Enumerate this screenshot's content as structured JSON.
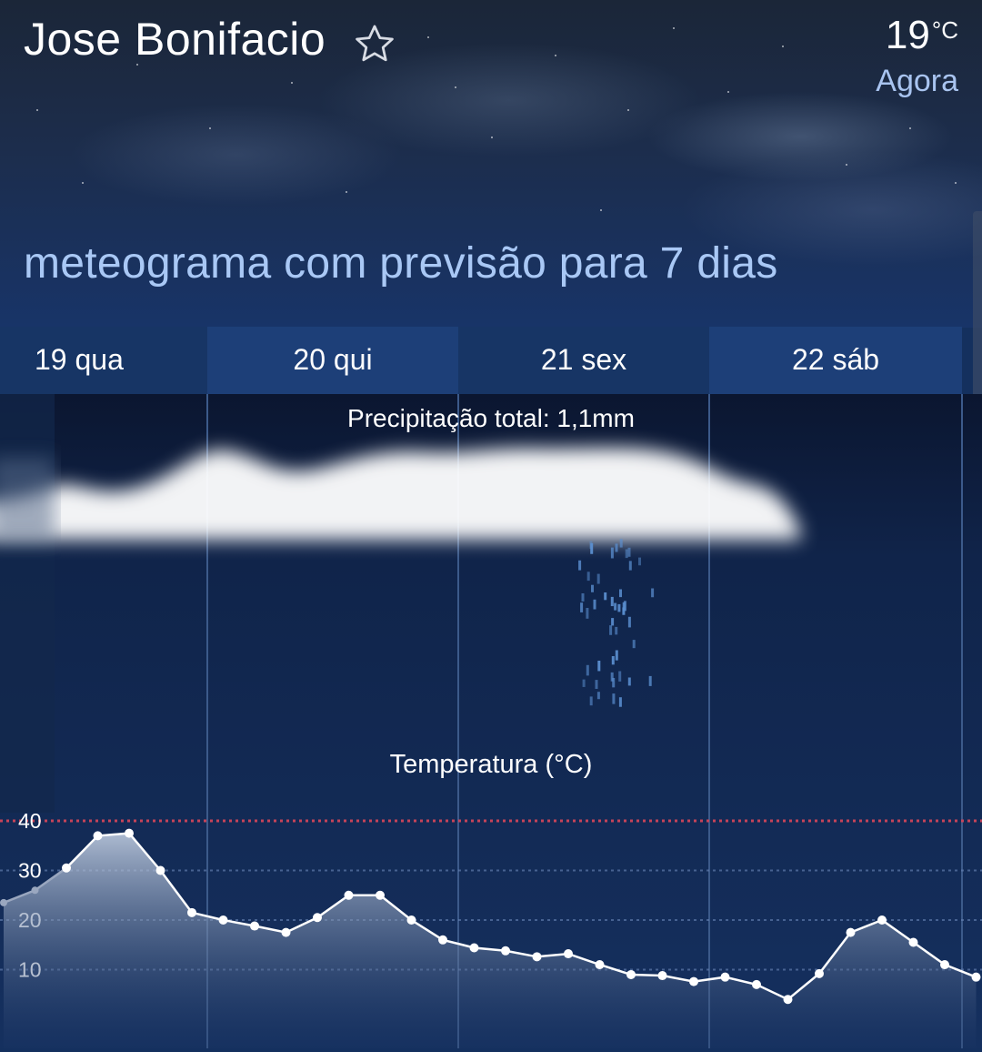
{
  "header": {
    "city": "Jose Bonifacio",
    "temperature": "19",
    "temperature_unit": "°C",
    "time_label": "Agora",
    "favorite_icon": "star-outline-icon"
  },
  "meteogram": {
    "title": "meteograma com previsão para 7 dias",
    "days": [
      "19 qua",
      "20 qui",
      "21 sex",
      "22 sáb"
    ],
    "precipitation_label": "Precipitação total: 1,1mm",
    "temperature_label": "Temperatura (°C)"
  },
  "chart_data": {
    "type": "area",
    "title": "Temperatura (°C)",
    "y_ticks": [
      "40",
      "30",
      "20",
      "10"
    ],
    "ylim": [
      0,
      40
    ],
    "grid": true,
    "threshold_line": 40,
    "values": [
      23.5,
      26,
      30.5,
      37,
      37.5,
      30,
      21.5,
      20,
      18.8,
      17.5,
      20.5,
      25,
      25,
      20,
      16,
      14.4,
      13.8,
      12.6,
      13.2,
      11,
      9,
      8.8,
      7.6,
      8.5,
      7,
      4,
      9.2,
      17.5,
      20,
      15.5,
      11,
      8.5
    ],
    "colors": {
      "line": "#ffffff",
      "threshold": "#d0455a",
      "grid": "#6a86b8"
    }
  }
}
